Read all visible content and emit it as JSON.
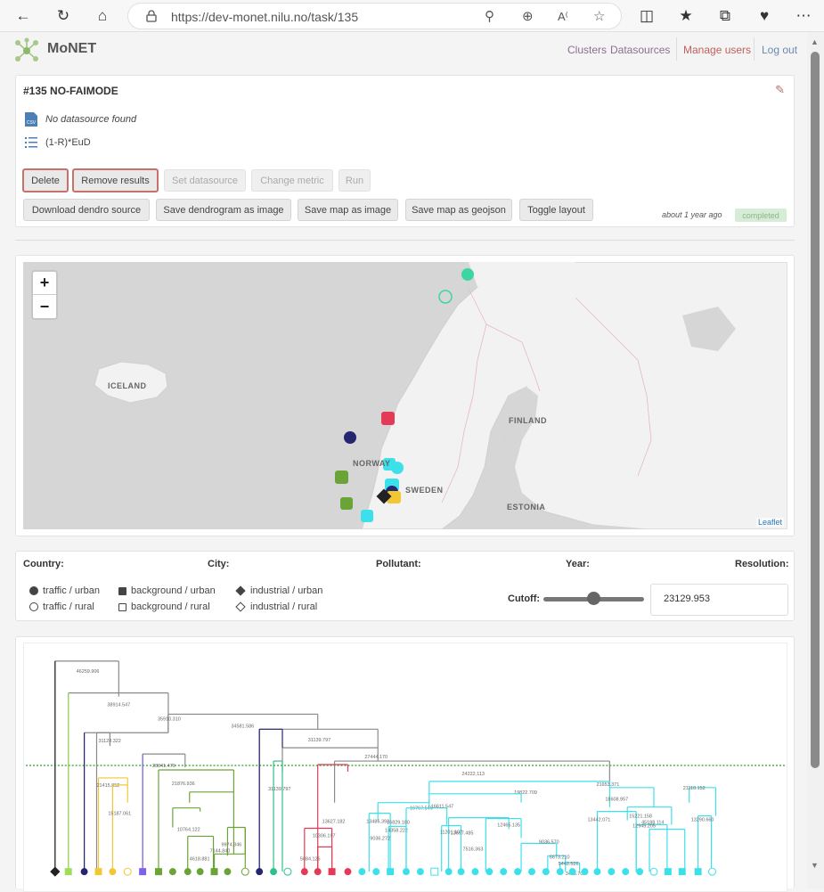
{
  "browser": {
    "url": "https://dev-monet.nilu.no/task/135"
  },
  "header": {
    "brand": "MoNET",
    "nav": [
      "Clusters",
      "Datasources",
      "Manage users",
      "Log out"
    ]
  },
  "task": {
    "title": "#135 NO-FAIMODE",
    "datasource": "No datasource found",
    "metric": "(1-R)*EuD",
    "buttons_row1": [
      "Delete",
      "Remove results",
      "Set datasource",
      "Change metric",
      "Run"
    ],
    "buttons_row2": [
      "Download dendro source",
      "Save dendrogram as image",
      "Save map as image",
      "Save map as geojson",
      "Toggle layout"
    ],
    "time": "about 1 year ago",
    "status": "completed"
  },
  "map": {
    "zoom_in": "+",
    "zoom_out": "−",
    "labels": [
      "ICELAND",
      "FINLAND",
      "NORWAY",
      "SWEDEN",
      "ESTONIA"
    ],
    "attribution": "Leaflet"
  },
  "filters": {
    "labels": [
      "Country:",
      "City:",
      "Pollutant:",
      "Year:",
      "Resolution:"
    ],
    "legend": [
      [
        "traffic / urban",
        "background / urban",
        "industrial / urban"
      ],
      [
        "traffic / rural",
        "background / rural",
        "industrial / rural"
      ]
    ],
    "cutoff_label": "Cutoff:",
    "cutoff_value": "23129.953",
    "cutoff_fraction": 0.55
  },
  "dendrogram": {
    "merge_labels": [
      "46259.906",
      "38914.547",
      "35910.310",
      "34581.586",
      "31128.322",
      "31139.797",
      "27444.170",
      "24222.113",
      "28341.479",
      "21876.936",
      "21415.852",
      "19822.709",
      "21653.371",
      "21110.152",
      "16829.180",
      "18608.957",
      "16767.549",
      "16611.547",
      "14358.222",
      "13627.182",
      "13697.485",
      "13486.393",
      "13442.071",
      "15221.158",
      "12945.205",
      "13290.660",
      "10764.122",
      "9974.846",
      "13806.921",
      "11201.107",
      "12465.135",
      "9036.272",
      "9036.570",
      "7516.363",
      "6673.210",
      "5442.526",
      "10306.197",
      "7144.840",
      "4618.881",
      "5084.126",
      "15187.061",
      "45188.114",
      "3435.702"
    ]
  },
  "colors": {
    "accent_red": "#c9706a",
    "link_purple": "#8b6f8e",
    "link_blue": "#6a89b2",
    "cutoff_line": "#2e9a2e",
    "cyan": "#3ce0eb",
    "green": "#6aa436",
    "yellow": "#f2c734",
    "navy": "#26256f",
    "red": "#e23a57"
  }
}
